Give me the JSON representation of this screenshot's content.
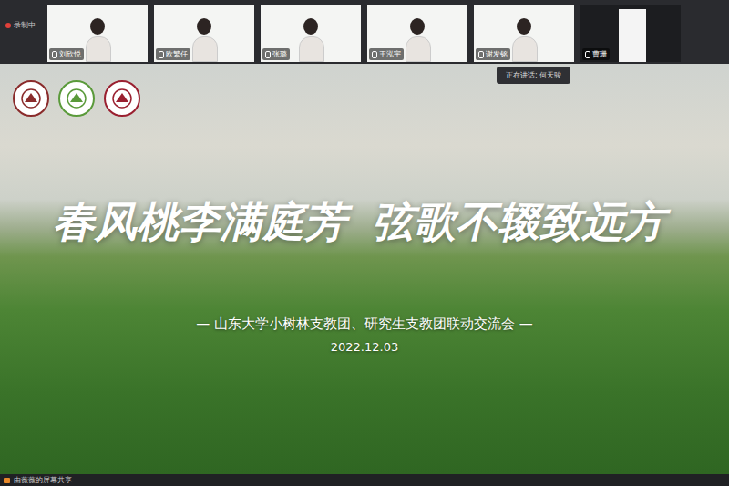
{
  "recording": {
    "label": "录制中"
  },
  "participants": [
    {
      "name": "刘欣悦",
      "camera": "on"
    },
    {
      "name": "欧繁任",
      "camera": "on"
    },
    {
      "name": "张璐",
      "camera": "on"
    },
    {
      "name": "王泓宇",
      "camera": "on"
    },
    {
      "name": "谢发铭",
      "camera": "on"
    },
    {
      "name": "曹珊",
      "camera": "small"
    }
  ],
  "speaking": "正在讲话: 何天骏",
  "slide": {
    "title_left": "春风桃李满庭芳",
    "title_right": "弦歌不辍致远方",
    "subtitle": "— 山东大学小树林支教团、研究生支教团联动交流会 —",
    "date": "2022.12.03"
  },
  "status_bar": "由薇薇的屏幕共享"
}
